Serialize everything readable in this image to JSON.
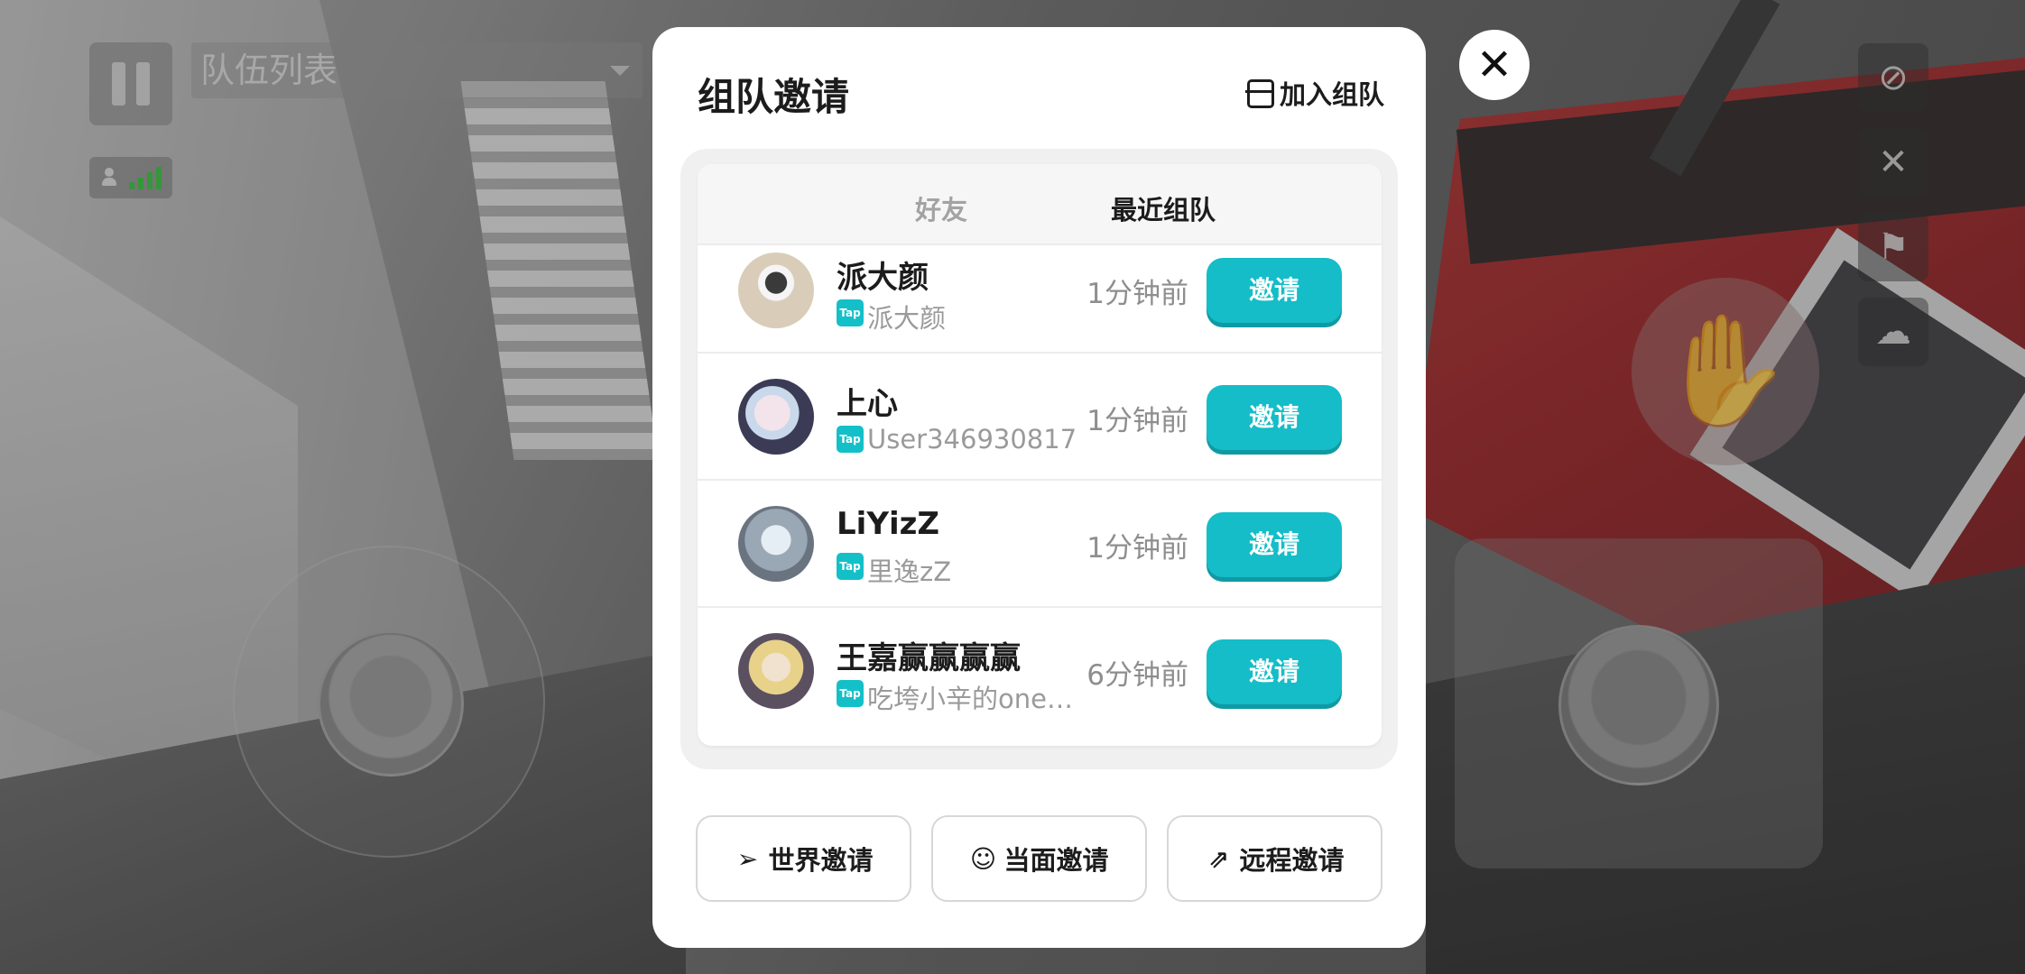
{
  "hud": {
    "team_list_label": "队伍列表"
  },
  "modal": {
    "title": "组队邀请",
    "join_team_label": "加入组队",
    "tabs": [
      {
        "label": "好友",
        "active": false
      },
      {
        "label": "最近组队",
        "active": true
      }
    ],
    "rows": [
      {
        "name": "派大颜",
        "platform": "Tap",
        "sub": "派大颜",
        "time": "1分钟前",
        "action": "邀请"
      },
      {
        "name": "上心",
        "platform": "Tap",
        "sub": "User346930817",
        "time": "1分钟前",
        "action": "邀请"
      },
      {
        "name": "LiYizZ",
        "platform": "Tap",
        "sub": "里逸zZ",
        "time": "1分钟前",
        "action": "邀请"
      },
      {
        "name": "王嘉赢赢赢赢",
        "platform": "Tap",
        "sub": "吃垮小辛的one…",
        "time": "6分钟前",
        "action": "邀请"
      }
    ],
    "bottom_buttons": [
      {
        "label": "世界邀请",
        "icon": "send-icon"
      },
      {
        "label": "当面邀请",
        "icon": "face-icon"
      },
      {
        "label": "远程邀请",
        "icon": "share-icon"
      }
    ],
    "close_icon": "close-icon"
  },
  "colors": {
    "accent": "#14bdc8",
    "tap_badge": "#14c0c8",
    "signal_green": "#33b43a"
  }
}
